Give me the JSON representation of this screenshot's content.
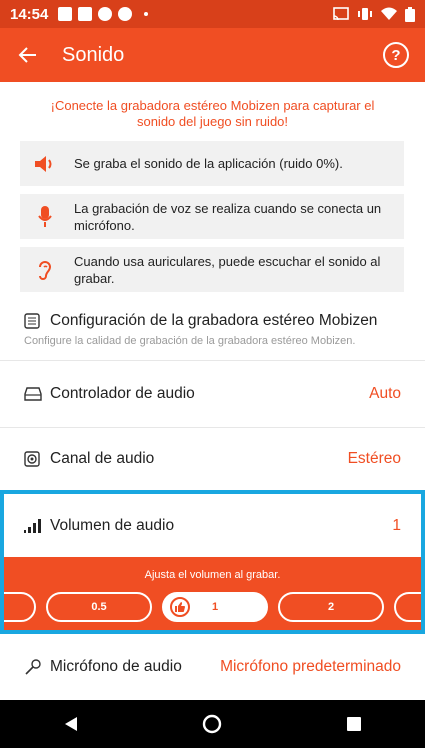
{
  "status_bar": {
    "time": "14:54"
  },
  "app_bar": {
    "title": "Sonido",
    "help_label": "?"
  },
  "notice": "¡Conecte la grabadora estéreo Mobizen para capturar el sonido del juego sin ruido!",
  "info_items": [
    {
      "icon": "speaker-icon",
      "text": "Se graba el sonido de la aplicación (ruido 0%)."
    },
    {
      "icon": "microphone-icon",
      "text": "La grabación de voz se realiza cuando se conecta un micrófono."
    },
    {
      "icon": "ear-icon",
      "text": "Cuando usa auriculares, puede escuchar el sonido al grabar."
    }
  ],
  "stereo_config": {
    "title": "Configuración de la grabadora estéreo Mobizen",
    "subtitle": "Configure la calidad de grabación de la grabadora estéreo Mobizen."
  },
  "settings": [
    {
      "icon": "drive-icon",
      "label": "Controlador de audio",
      "value": "Auto"
    },
    {
      "icon": "speaker-box-icon",
      "label": "Canal de audio",
      "value": "Estéreo"
    },
    {
      "icon": "signal-bars-icon",
      "label": "Volumen de audio",
      "value": "1"
    },
    {
      "icon": "microphone-outline-icon",
      "label": "Micrófono de audio",
      "value": "Micrófono predeterminado"
    }
  ],
  "volume_panel": {
    "hint": "Ajusta el volumen al grabar.",
    "options": [
      "0.5",
      "1",
      "2"
    ],
    "selected": "1"
  },
  "colors": {
    "accent": "#f04e23",
    "status_bar": "#d8401a",
    "highlight": "#19a7e0"
  }
}
